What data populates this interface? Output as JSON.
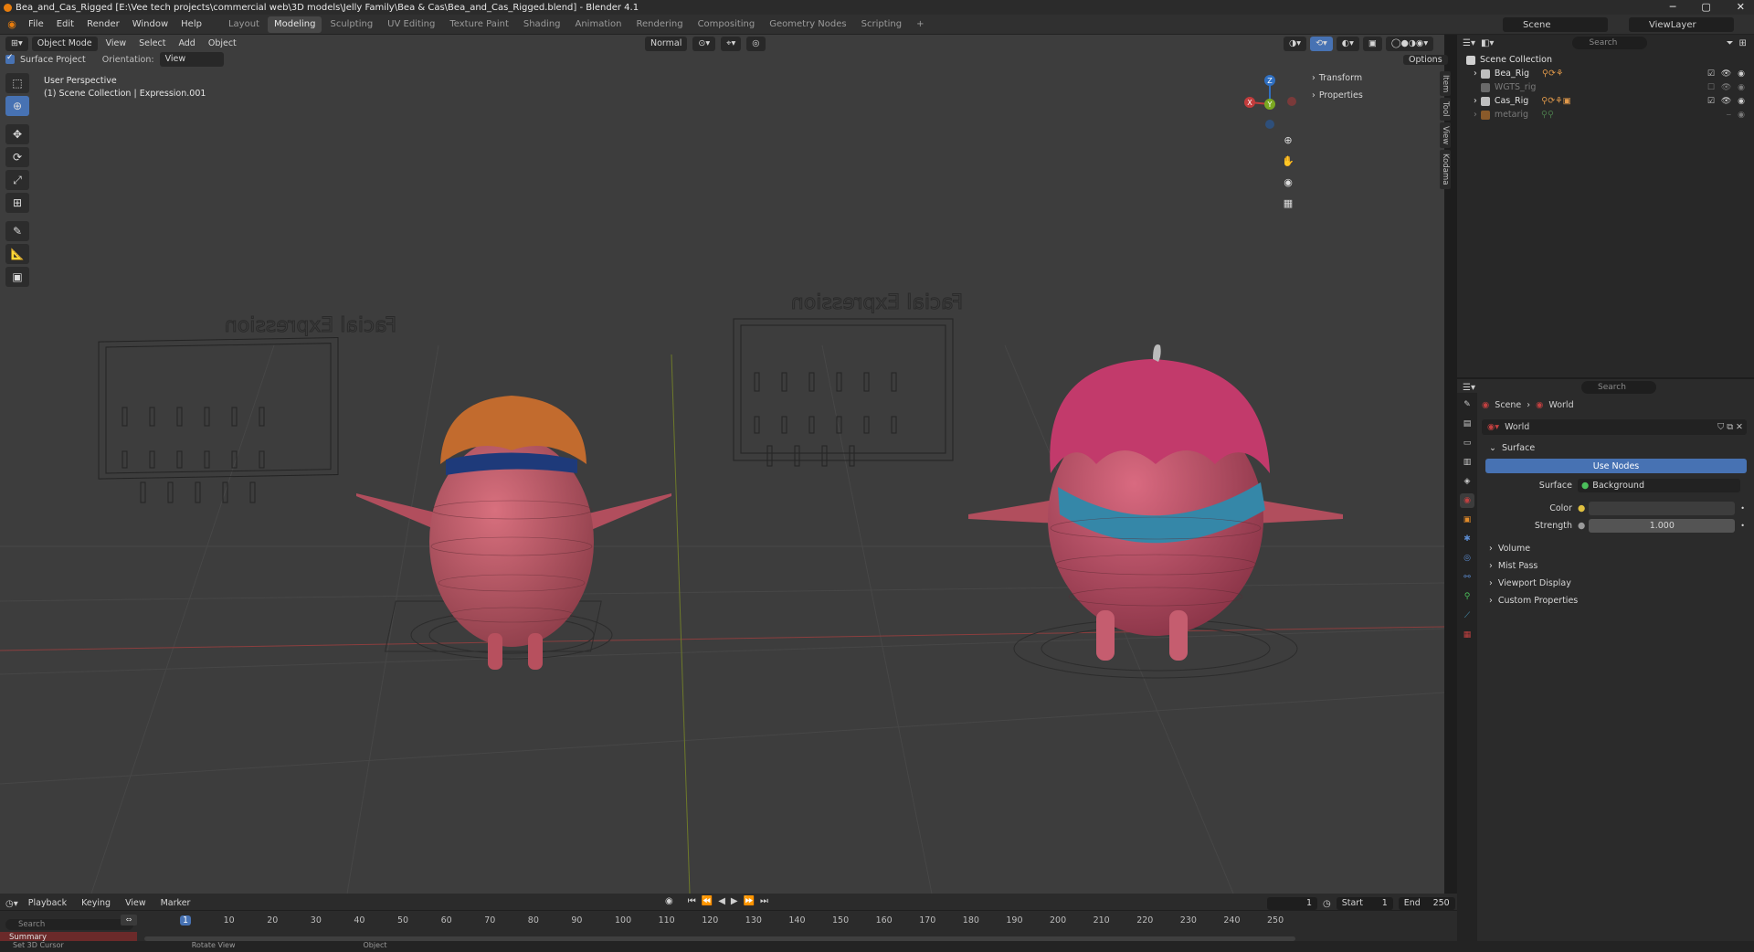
{
  "window": {
    "title": "Bea_and_Cas_Rigged [E:\\Vee tech projects\\commercial web\\3D models\\Jelly Family\\Bea & Cas\\Bea_and_Cas_Rigged.blend] - Blender 4.1"
  },
  "menu": [
    "File",
    "Edit",
    "Render",
    "Window",
    "Help"
  ],
  "workspaces": {
    "tabs": [
      "Layout",
      "Modeling",
      "Sculpting",
      "UV Editing",
      "Texture Paint",
      "Shading",
      "Animation",
      "Rendering",
      "Compositing",
      "Geometry Nodes",
      "Scripting"
    ],
    "active": "Modeling"
  },
  "scene": {
    "name": "Scene",
    "view_layer": "ViewLayer"
  },
  "viewport": {
    "mode": "Object Mode",
    "menus": [
      "View",
      "Select",
      "Add",
      "Object"
    ],
    "transform_orientation": "Normal",
    "surface_project_label": "Surface Project",
    "surface_project_checked": true,
    "orientation_label": "Orientation:",
    "orientation_value": "View",
    "options_label": "Options",
    "overlay_line1": "User Perspective",
    "overlay_line2": "(1) Scene Collection | Expression.001",
    "board_title": "Facial Expression",
    "npanel": [
      "Transform",
      "Properties"
    ],
    "side_tabs": [
      "Item",
      "Tool",
      "View",
      "Kodama"
    ],
    "gizmo_axes": [
      "X",
      "Y",
      "Z"
    ]
  },
  "outliner": {
    "search_placeholder": "Search",
    "root": "Scene Collection",
    "items": [
      {
        "name": "Bea_Rig",
        "dimmed": false
      },
      {
        "name": "WGTS_rig",
        "dimmed": true
      },
      {
        "name": "Cas_Rig",
        "dimmed": false
      },
      {
        "name": "metarig",
        "dimmed": true
      }
    ]
  },
  "properties": {
    "search_placeholder": "Search",
    "breadcrumb": [
      "Scene",
      "World"
    ],
    "datablock": "World",
    "surface_panel": "Surface",
    "use_nodes_label": "Use Nodes",
    "surface_label": "Surface",
    "surface_value": "Background",
    "color_label": "Color",
    "strength_label": "Strength",
    "strength_value": "1.000",
    "collapsed_panels": [
      "Volume",
      "Mist Pass",
      "Viewport Display",
      "Custom Properties"
    ]
  },
  "timeline": {
    "menus": [
      "Playback",
      "Keying",
      "View",
      "Marker"
    ],
    "current_frame": "1",
    "start_label": "Start",
    "start": "1",
    "end_label": "End",
    "end": "250",
    "ruler": [
      "1",
      "10",
      "20",
      "30",
      "40",
      "50",
      "60",
      "70",
      "80",
      "90",
      "100",
      "110",
      "120",
      "130",
      "140",
      "150",
      "160",
      "170",
      "180",
      "190",
      "200",
      "210",
      "220",
      "230",
      "240",
      "250"
    ],
    "search_placeholder": "Search",
    "summary_label": "Summary"
  },
  "status_bar": [
    "Set 3D Cursor",
    "Rotate View",
    "Object"
  ],
  "colors": {
    "accent": "#4772b3",
    "viewport_bg": "#3d3d3d",
    "character": "#c45a6a"
  }
}
